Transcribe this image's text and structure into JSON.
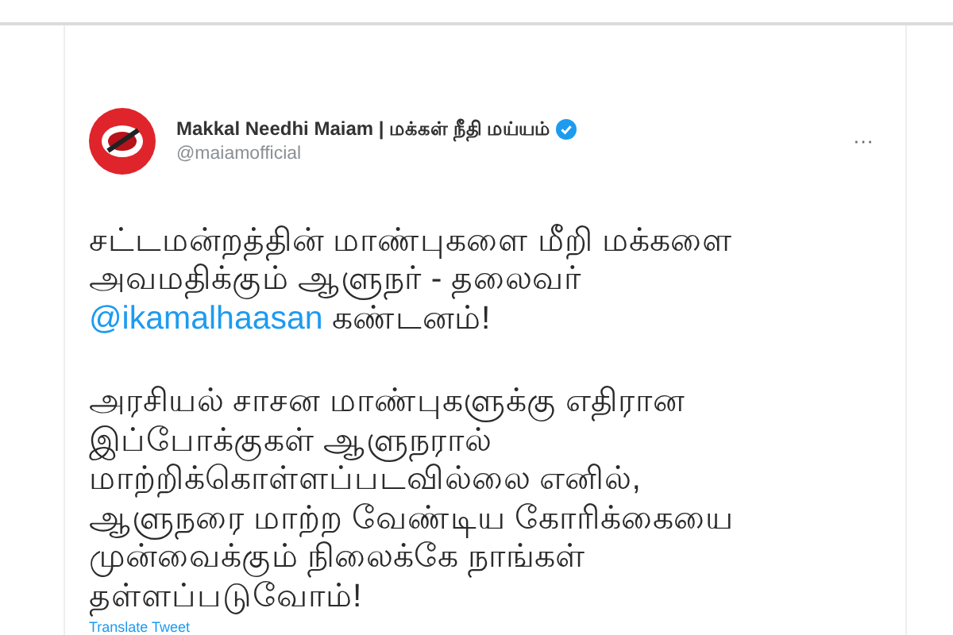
{
  "tweet": {
    "author_name": "Makkal Needhi Maiam | மக்கள் நீதி மய்யம்",
    "verified": true,
    "handle": "@maiamofficial",
    "more": "···",
    "paragraphs": [
      {
        "before": "சட்டமன்றத்தின் மாண்புகளை மீறி மக்களை\nஅவமதிக்கும் ஆளுநர் - தலைவர்\n",
        "mention": "@ikamalhaasan",
        "after": " கண்டனம்!"
      },
      {
        "before": "அரசியல் சாசன மாண்புகளுக்கு எதிரான\nஇப்போக்குகள் ஆளுநரால்\nமாற்றிக்கொள்ளப்படவில்லை எனில்,\nஆளுநரை மாற்ற வேண்டிய கோரிக்கையை\nமுன்வைக்கும் நிலைக்கே நாங்கள்\nதள்ளப்படுவோம்!"
      }
    ],
    "translate": "Translate Tweet"
  }
}
